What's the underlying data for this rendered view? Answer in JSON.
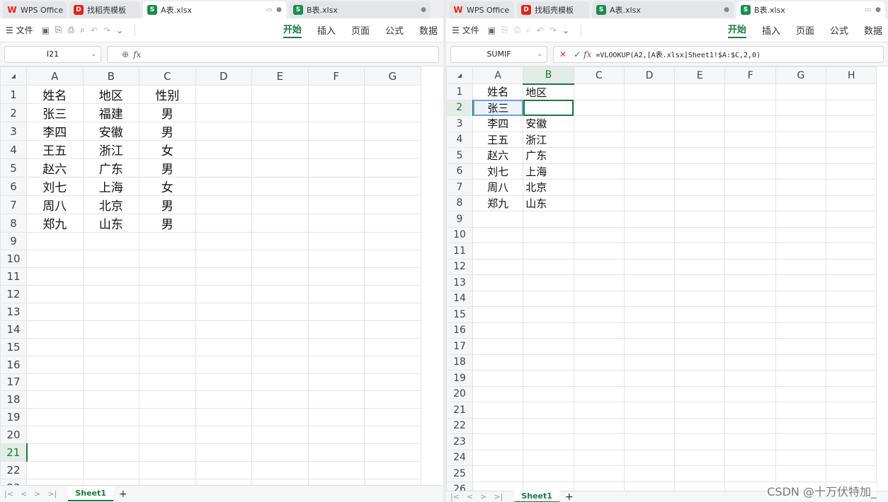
{
  "left": {
    "tabs": [
      {
        "label": "WPS Office",
        "icon": "wps-logo-icon"
      },
      {
        "label": "找稻壳模板",
        "icon": "docer-icon"
      },
      {
        "label": "A表.xlsx",
        "icon": "sheet-icon",
        "active": true
      },
      {
        "label": "B表.xlsx",
        "icon": "sheet-icon"
      }
    ],
    "toolbar": {
      "file": "☰ 文件",
      "menus": [
        "开始",
        "插入",
        "页面",
        "公式",
        "数据"
      ],
      "active_menu": "开始"
    },
    "namebox": "I21",
    "formula": "",
    "columns": [
      "A",
      "B",
      "C",
      "D",
      "E",
      "F",
      "G"
    ],
    "rows": [
      [
        "姓名",
        "地区",
        "性别"
      ],
      [
        "张三",
        "福建",
        "男"
      ],
      [
        "李四",
        "安徽",
        "男"
      ],
      [
        "王五",
        "浙江",
        "女"
      ],
      [
        "赵六",
        "广东",
        "男"
      ],
      [
        "刘七",
        "上海",
        "女"
      ],
      [
        "周八",
        "北京",
        "男"
      ],
      [
        "郑九",
        "山东",
        "男"
      ]
    ],
    "row_count": 23,
    "active_row": 21,
    "sheet": "Sheet1"
  },
  "right": {
    "tabs": [
      {
        "label": "WPS Office",
        "icon": "wps-logo-icon"
      },
      {
        "label": "找稻壳模板",
        "icon": "docer-icon"
      },
      {
        "label": "A表.xlsx",
        "icon": "sheet-icon"
      },
      {
        "label": "B表.xlsx",
        "icon": "sheet-icon",
        "active": true
      }
    ],
    "toolbar": {
      "file": "☰ 文件",
      "menus": [
        "开始",
        "插入",
        "页面",
        "公式",
        "数据"
      ],
      "active_menu": "开始"
    },
    "namebox": "SUMIF",
    "formula": "=VLOOKUP(A2,[A表.xlsx]Sheet1!$A:$C,2,0)",
    "editing": {
      "prefix": "=VLOOKUP(",
      "ref": "A2",
      "suffix": ",[A表.xlsx]Sheet1!$A:$C,2,0)"
    },
    "columns": [
      "A",
      "B",
      "C",
      "D",
      "E",
      "F",
      "G",
      "H"
    ],
    "rows": [
      [
        "姓名",
        "地区"
      ],
      [
        "张三",
        ""
      ],
      [
        "李四",
        "安徽"
      ],
      [
        "王五",
        "浙江"
      ],
      [
        "赵六",
        "广东"
      ],
      [
        "刘七",
        "上海"
      ],
      [
        "周八",
        "北京"
      ],
      [
        "郑九",
        "山东"
      ]
    ],
    "row_count": 26,
    "active_row": 2,
    "sheet": "Sheet1"
  },
  "watermark": "CSDN @十万伏特加_",
  "colors": {
    "accent": "#1a7a3d",
    "ref_highlight": "#6e9ee0"
  }
}
